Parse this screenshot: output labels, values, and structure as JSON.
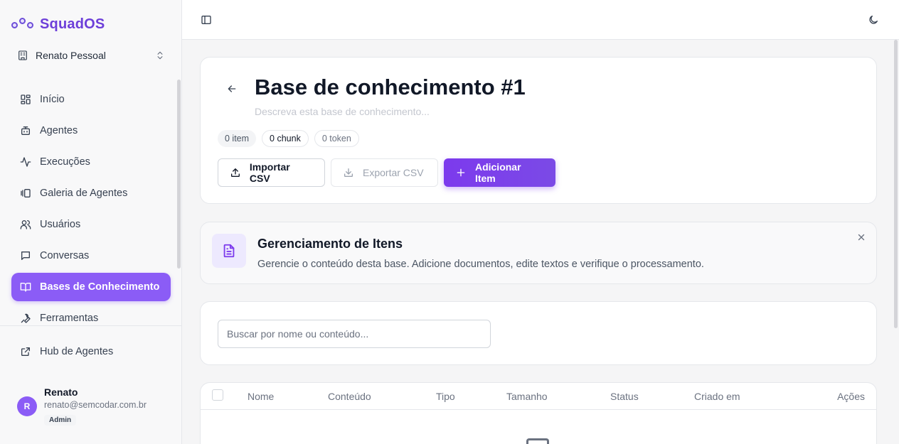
{
  "brand": {
    "name": "SquadOS"
  },
  "workspace": {
    "name": "Renato Pessoal"
  },
  "sidebar": {
    "items": [
      {
        "label": "Início",
        "icon": "dashboard-icon"
      },
      {
        "label": "Agentes",
        "icon": "bot-icon"
      },
      {
        "label": "Execuções",
        "icon": "activity-icon"
      },
      {
        "label": "Galeria de Agentes",
        "icon": "gallery-icon"
      },
      {
        "label": "Usuários",
        "icon": "users-icon"
      },
      {
        "label": "Conversas",
        "icon": "chat-icon"
      },
      {
        "label": "Bases de Conhecimento",
        "icon": "book-icon",
        "active": true
      },
      {
        "label": "Ferramentas",
        "icon": "wrench-icon"
      }
    ],
    "hub": {
      "label": "Hub de Agentes",
      "icon": "external-link-icon"
    }
  },
  "user": {
    "initial": "R",
    "name": "Renato",
    "email": "renato@semcodar.com.br",
    "role": "Admin"
  },
  "header": {
    "title": "Base de conhecimento #1",
    "description_placeholder": "Descreva esta base de conhecimento...",
    "stats": {
      "items": "0 item",
      "chunks": "0 chunk",
      "tokens": "0 token"
    },
    "buttons": {
      "import": "Importar CSV",
      "export": "Exportar CSV",
      "add": "Adicionar Item"
    }
  },
  "info": {
    "title": "Gerenciamento de Itens",
    "text": "Gerencie o conteúdo desta base. Adicione documentos, edite textos e verifique o processamento."
  },
  "search": {
    "placeholder": "Buscar por nome ou conteúdo..."
  },
  "table": {
    "columns": {
      "name": "Nome",
      "content": "Conteúdo",
      "type": "Tipo",
      "size": "Tamanho",
      "status": "Status",
      "created": "Criado em",
      "actions": "Ações"
    }
  },
  "colors": {
    "accent": "#7c3aed",
    "active_nav": "#8b5cf6"
  }
}
